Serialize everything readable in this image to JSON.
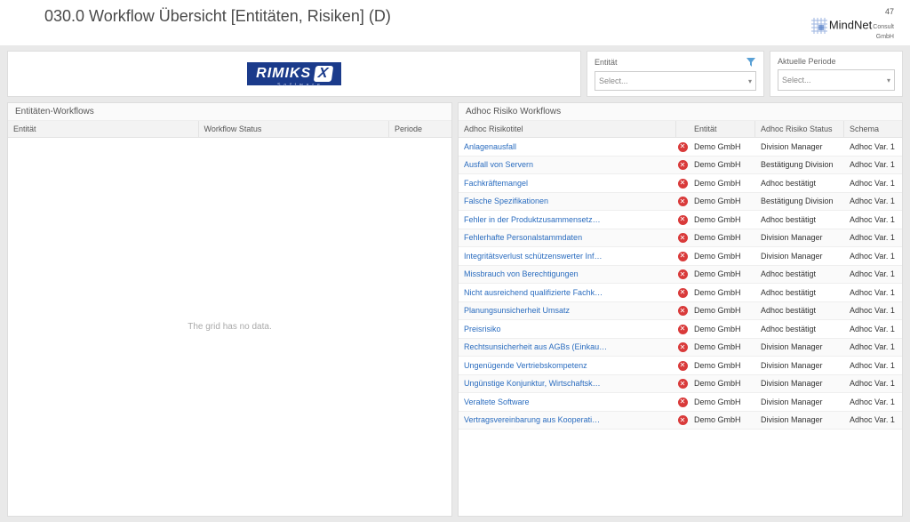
{
  "slide": {
    "title": "030.0 Workflow Übersicht [Entitäten, Risiken] (D)",
    "page_number": "47",
    "brand_main": "MindNet",
    "brand_sub": "Consult",
    "brand_sub2": "GmbH"
  },
  "logo": {
    "text": "RIMIKS",
    "badge": "X",
    "subtitle": "Software"
  },
  "filters": {
    "entitaet": {
      "label": "Entität",
      "placeholder": "Select..."
    },
    "periode": {
      "label": "Aktuelle Periode",
      "placeholder": "Select..."
    }
  },
  "left_grid": {
    "title": "Entitäten-Workflows",
    "columns": {
      "c1": "Entität",
      "c2": "Workflow Status",
      "c3": "Periode"
    },
    "empty_text": "The grid has no data."
  },
  "right_grid": {
    "title": "Adhoc Risiko Workflows",
    "columns": {
      "c1": "Adhoc Risikotitel",
      "c3": "Entität",
      "c4": "Adhoc Risiko Status",
      "c5": "Schema"
    },
    "rows": [
      {
        "title": "Anlagenausfall",
        "entitaet": "Demo GmbH",
        "status": "Division Manager",
        "schema": "Adhoc Var. 1"
      },
      {
        "title": "Ausfall von Servern",
        "entitaet": "Demo GmbH",
        "status": "Bestätigung Division",
        "schema": "Adhoc Var. 1"
      },
      {
        "title": "Fachkräftemangel",
        "entitaet": "Demo GmbH",
        "status": "Adhoc bestätigt",
        "schema": "Adhoc Var. 1"
      },
      {
        "title": "Falsche Spezifikationen",
        "entitaet": "Demo GmbH",
        "status": "Bestätigung Division",
        "schema": "Adhoc Var. 1"
      },
      {
        "title": "Fehler in der Produktzusammensetz…",
        "entitaet": "Demo GmbH",
        "status": "Adhoc bestätigt",
        "schema": "Adhoc Var. 1"
      },
      {
        "title": "Fehlerhafte Personalstammdaten",
        "entitaet": "Demo GmbH",
        "status": "Division Manager",
        "schema": "Adhoc Var. 1"
      },
      {
        "title": "Integritätsverlust schützenswerter Inf…",
        "entitaet": "Demo GmbH",
        "status": "Division Manager",
        "schema": "Adhoc Var. 1"
      },
      {
        "title": "Missbrauch von Berechtigungen",
        "entitaet": "Demo GmbH",
        "status": "Adhoc bestätigt",
        "schema": "Adhoc Var. 1"
      },
      {
        "title": "Nicht ausreichend qualifizierte Fachk…",
        "entitaet": "Demo GmbH",
        "status": "Adhoc bestätigt",
        "schema": "Adhoc Var. 1"
      },
      {
        "title": "Planungsunsicherheit Umsatz",
        "entitaet": "Demo GmbH",
        "status": "Adhoc bestätigt",
        "schema": "Adhoc Var. 1"
      },
      {
        "title": "Preisrisiko",
        "entitaet": "Demo GmbH",
        "status": "Adhoc bestätigt",
        "schema": "Adhoc Var. 1"
      },
      {
        "title": "Rechtsunsicherheit aus AGBs (Einkau…",
        "entitaet": "Demo GmbH",
        "status": "Division Manager",
        "schema": "Adhoc Var. 1"
      },
      {
        "title": "Ungenügende Vertriebskompetenz",
        "entitaet": "Demo GmbH",
        "status": "Division Manager",
        "schema": "Adhoc Var. 1"
      },
      {
        "title": "Ungünstige Konjunktur, Wirtschaftsk…",
        "entitaet": "Demo GmbH",
        "status": "Division Manager",
        "schema": "Adhoc Var. 1"
      },
      {
        "title": "Veraltete Software",
        "entitaet": "Demo GmbH",
        "status": "Division Manager",
        "schema": "Adhoc Var. 1"
      },
      {
        "title": "Vertragsvereinbarung aus Kooperati…",
        "entitaet": "Demo GmbH",
        "status": "Division Manager",
        "schema": "Adhoc Var. 1"
      }
    ]
  }
}
